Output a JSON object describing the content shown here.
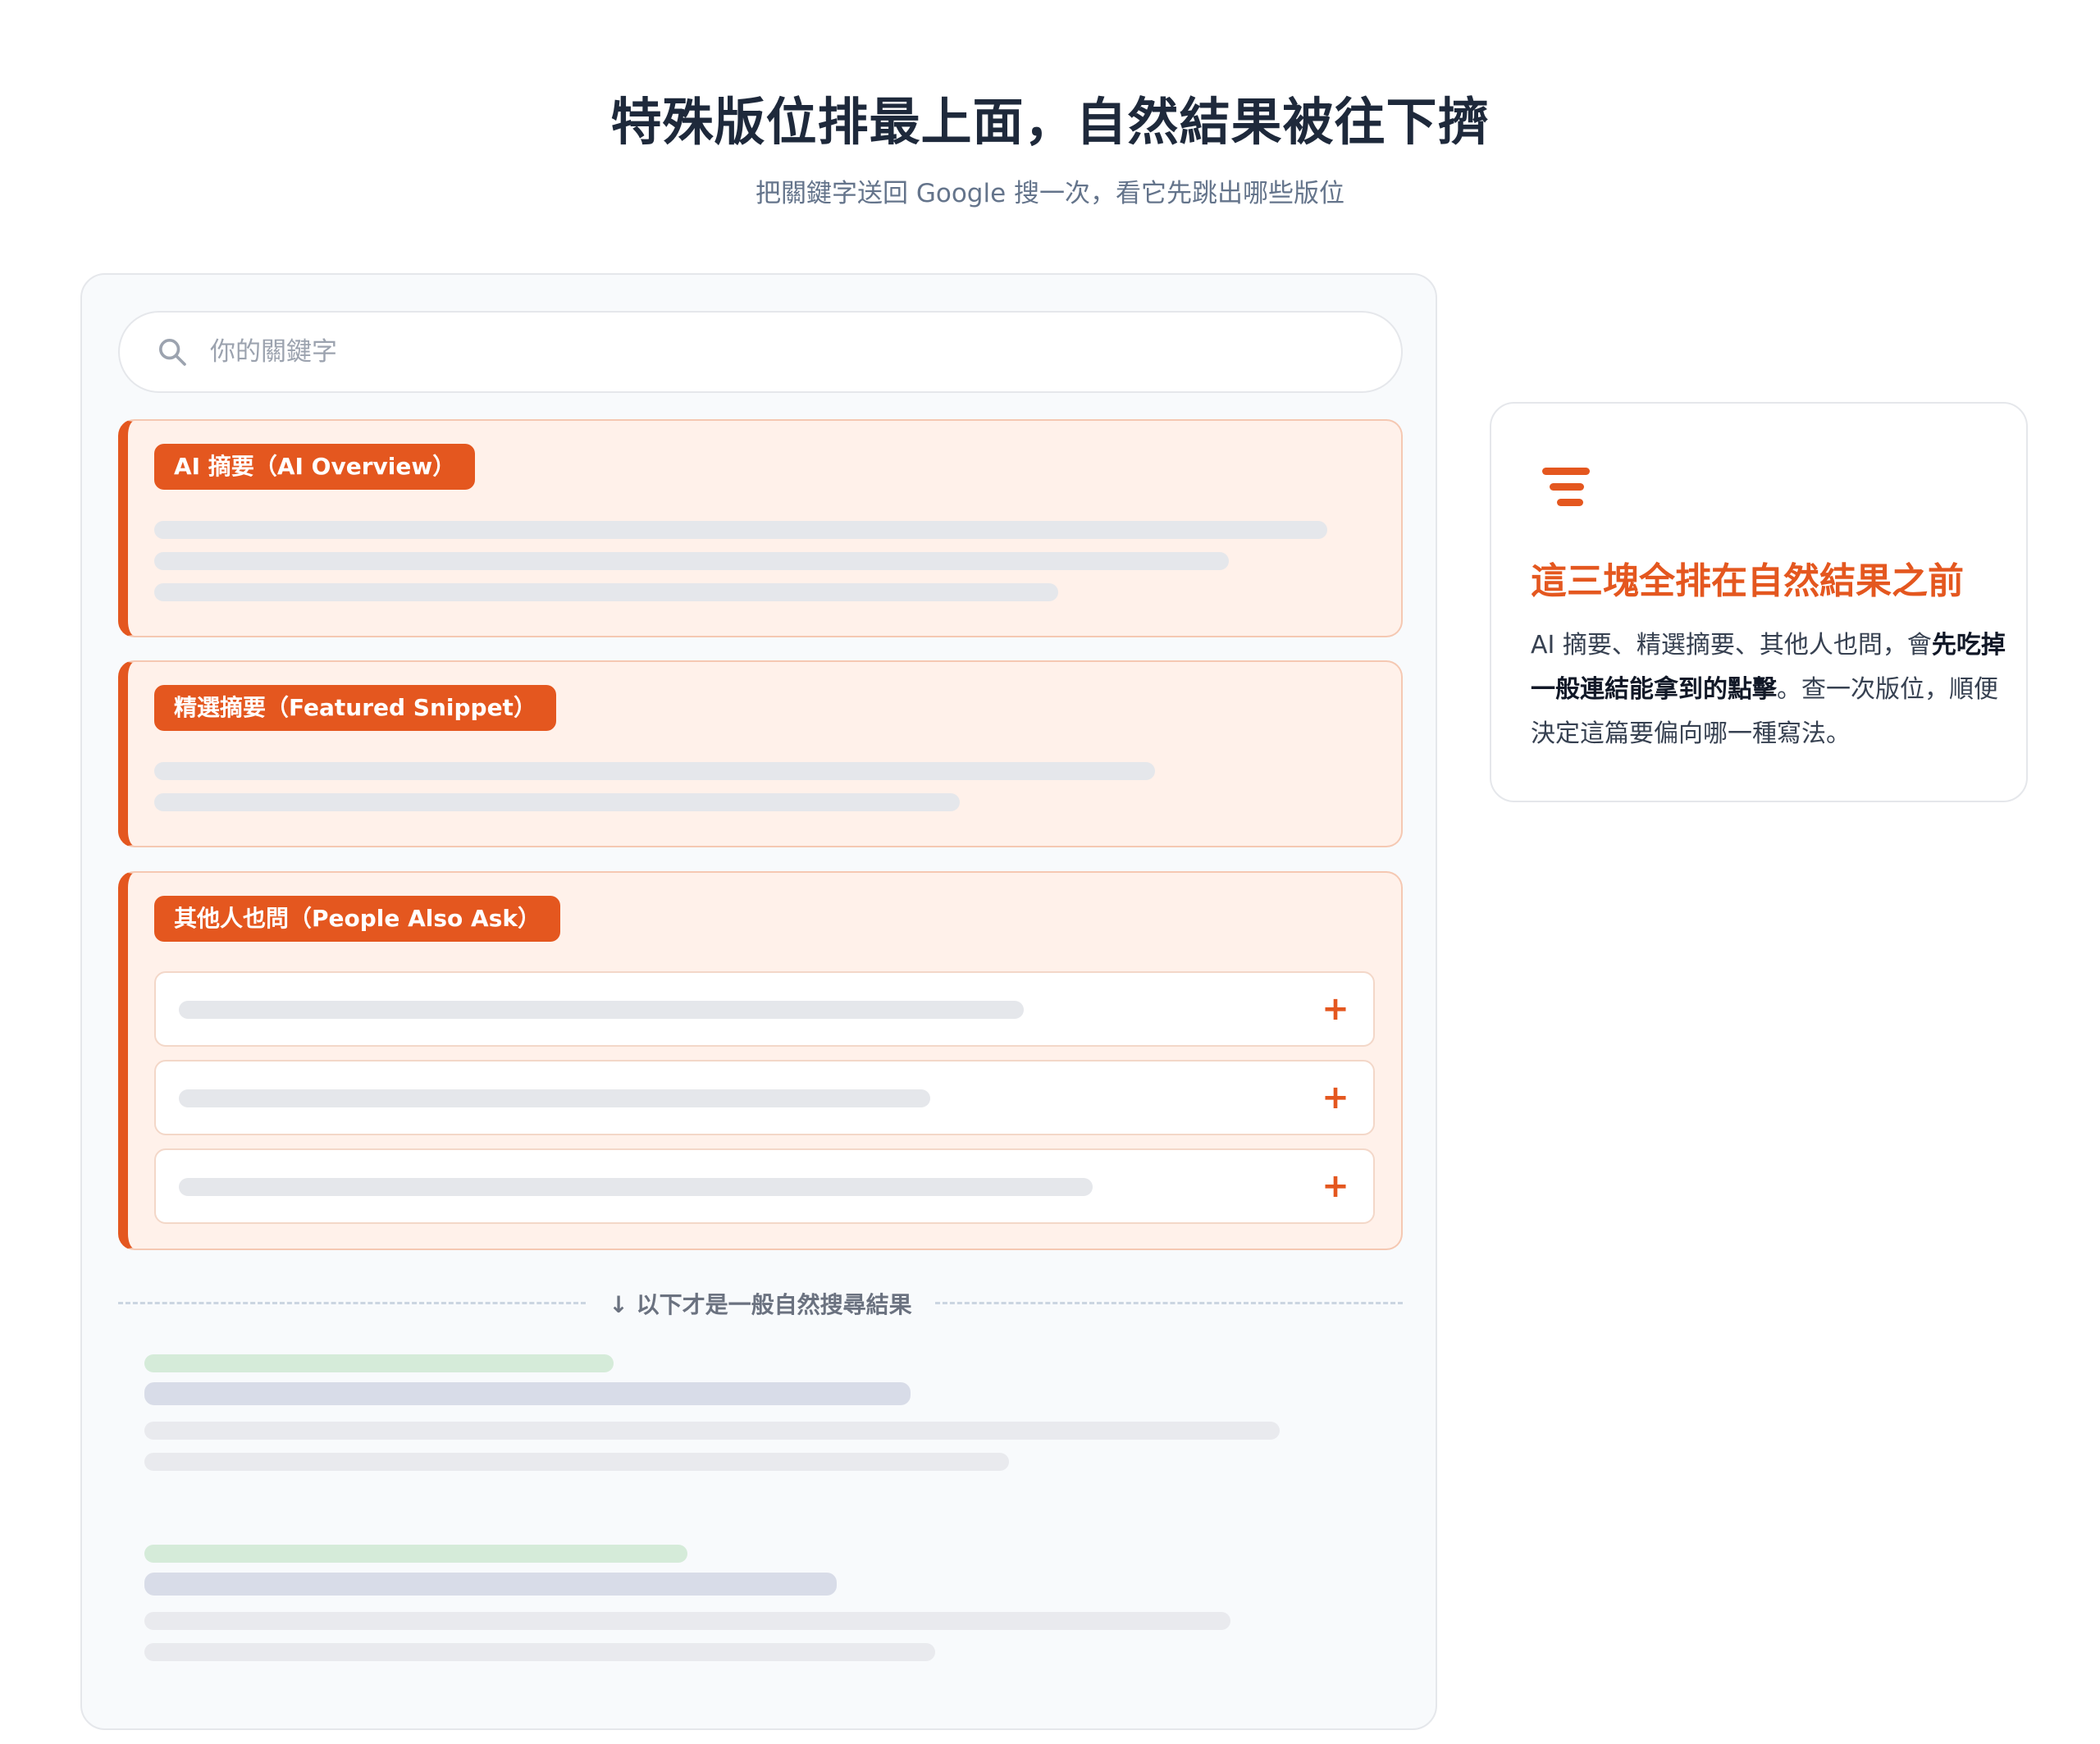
{
  "hero": {
    "title": "特殊版位排最上面，自然結果被往下擠",
    "subtitle": "把關鍵字送回 Google 搜一次，看它先跳出哪些版位"
  },
  "search": {
    "placeholder": "你的關鍵字",
    "icon": "search-icon"
  },
  "features": {
    "ai_overview": {
      "label": "AI 摘要（AI Overview）"
    },
    "featured_snippet": {
      "label": "精選摘要（Featured Snippet）"
    },
    "people_also_ask": {
      "label": "其他人也問（People Also Ask）",
      "expand_symbol": "+"
    }
  },
  "divider": {
    "label": "↓ 以下才是一般自然搜尋結果"
  },
  "info_card": {
    "icon": "stacked-layers-icon",
    "title": "這三塊全排在自然結果之前",
    "body_before": "AI 摘要、精選摘要、其他人也問，會",
    "body_bold": "先吃掉一般連結能拿到的點擊",
    "body_after": "。查一次版位，順便決定這篇要偏向哪一種寫法。"
  },
  "colors": {
    "accent": "#e4571f",
    "feature_bg": "#fff1ea",
    "url_skeleton": "#d5ebd9",
    "title_skeleton": "#d8dce8",
    "text_skeleton": "#e9eaee"
  }
}
